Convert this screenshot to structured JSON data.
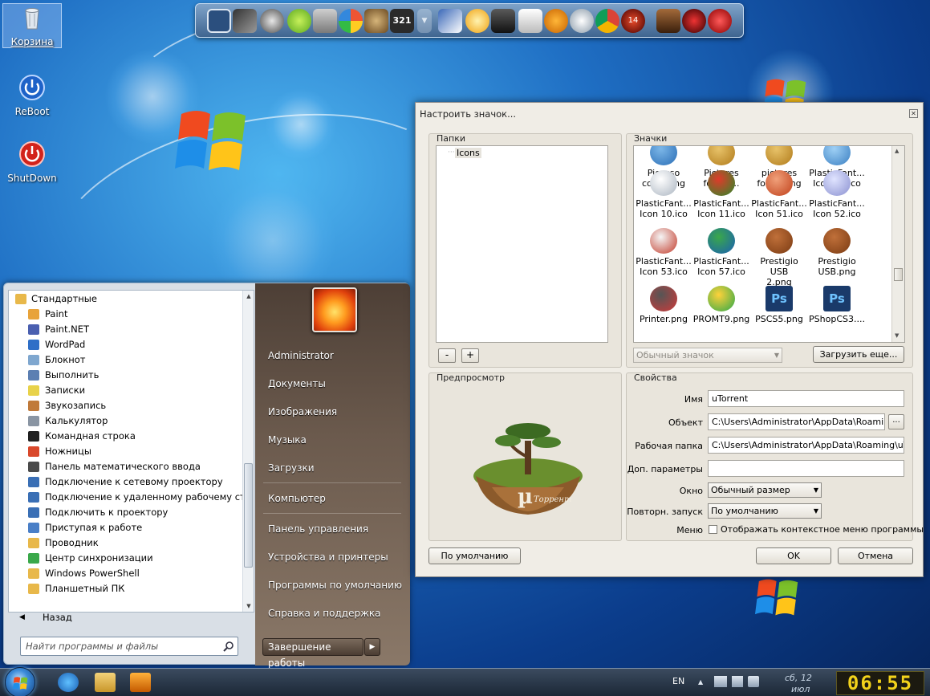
{
  "desktop": {
    "icons": [
      {
        "label": "Корзина",
        "icon": "recycle-bin-icon"
      },
      {
        "label": "ReBoot",
        "icon": "power-icon"
      },
      {
        "label": "ShutDown",
        "icon": "power-red-icon"
      }
    ]
  },
  "dock": {
    "items": [
      "tablet-icon",
      "phone-icon",
      "tools-icon",
      "skype-icon",
      "speaker-icon",
      "picasa-icon",
      "utorrent-icon",
      "media-player-321-icon",
      "dropdown-icon",
      "photo-icon",
      "alarm-clock-icon",
      "video-icon",
      "firefox-fox-icon",
      "aimp-icon",
      "fan-icon",
      "chrome-icon",
      "ccleaner-14-icon",
      "doll-icon",
      "hat-icon",
      "opera-icon"
    ]
  },
  "start_menu": {
    "folder": "Стандартные",
    "items": [
      {
        "label": "Paint",
        "color": "#e8a33a"
      },
      {
        "label": "Paint.NET",
        "color": "#4a5fb0"
      },
      {
        "label": "WordPad",
        "color": "#2f6fc7"
      },
      {
        "label": "Блокнот",
        "color": "#7fa7cf"
      },
      {
        "label": "Выполнить",
        "color": "#5c7fb2"
      },
      {
        "label": "Записки",
        "color": "#e8d24a"
      },
      {
        "label": "Звукозапись",
        "color": "#c07a3a"
      },
      {
        "label": "Калькулятор",
        "color": "#8a95a3"
      },
      {
        "label": "Командная строка",
        "color": "#202020"
      },
      {
        "label": "Ножницы",
        "color": "#d9482b"
      },
      {
        "label": "Панель математического ввода",
        "color": "#4a4a4a"
      },
      {
        "label": "Подключение к сетевому проектору",
        "color": "#3a6fb5"
      },
      {
        "label": "Подключение к удаленному рабочему стол",
        "color": "#3a6fb5"
      },
      {
        "label": "Подключить к проектору",
        "color": "#3a6fb5"
      },
      {
        "label": "Приступая к работе",
        "color": "#4a7fc7"
      },
      {
        "label": "Проводник",
        "color": "#e8b84a"
      },
      {
        "label": "Центр синхронизации",
        "color": "#3aa84a"
      },
      {
        "label": "Windows PowerShell",
        "color": "#e8b84a"
      },
      {
        "label": "Планшетный ПК",
        "color": "#e8b84a"
      }
    ],
    "back": "Назад",
    "search_placeholder": "Найти программы и файлы",
    "right_links": [
      "Administrator",
      "Документы",
      "Изображения",
      "Музыка",
      "Загрузки",
      "Компьютер",
      "Панель управления",
      "Устройства и принтеры",
      "Программы по умолчанию",
      "Справка и поддержка"
    ],
    "shutdown": "Завершение работы"
  },
  "dialog": {
    "title": "Настроить значок...",
    "folders_title": "Папки",
    "folder_item": "Icons",
    "icons_title": "Значки",
    "icons": [
      {
        "label": "Picasso copia.png",
        "line1": "Picasso",
        "line2": "copia.png"
      },
      {
        "label": "Pictures folder....",
        "line1": "Pictures",
        "line2": "folder...."
      },
      {
        "label": "pictures folder.png",
        "line1": "pictures",
        "line2": "folder.png"
      },
      {
        "label": "PlasticFant... Icon 09.ico",
        "line1": "PlasticFant...",
        "line2": "Icon 09.ico"
      },
      {
        "label": "PlasticFant... Icon 10.ico",
        "line1": "PlasticFant...",
        "line2": "Icon 10.ico"
      },
      {
        "label": "PlasticFant... Icon 11.ico",
        "line1": "PlasticFant...",
        "line2": "Icon 11.ico"
      },
      {
        "label": "PlasticFant... Icon 51.ico",
        "line1": "PlasticFant...",
        "line2": "Icon 51.ico"
      },
      {
        "label": "PlasticFant... Icon 52.ico",
        "line1": "PlasticFant...",
        "line2": "Icon 52.ico"
      },
      {
        "label": "PlasticFant... Icon 53.ico",
        "line1": "PlasticFant...",
        "line2": "Icon 53.ico"
      },
      {
        "label": "PlasticFant... Icon 57.ico",
        "line1": "PlasticFant...",
        "line2": "Icon 57.ico"
      },
      {
        "label": "Prestigio USB 2.png",
        "line1": "Prestigio USB",
        "line2": "2.png"
      },
      {
        "label": "Prestigio USB.png",
        "line1": "Prestigio",
        "line2": "USB.png"
      },
      {
        "label": "Printer.png",
        "line1": "Printer.png",
        "line2": ""
      },
      {
        "label": "PROMT9.png",
        "line1": "PROMT9.png",
        "line2": ""
      },
      {
        "label": "PSCS5.png",
        "line1": "PSCS5.png",
        "line2": ""
      },
      {
        "label": "PShopCS3....",
        "line1": "PShopCS3....",
        "line2": ""
      }
    ],
    "minus": "-",
    "plus": "+",
    "icon_type": "Обычный значок",
    "load_more": "Загрузить еще...",
    "preview_title": "Предпросмотр",
    "preview_caption": "Торрент",
    "props_title": "Свойства",
    "props": {
      "name_label": "Имя",
      "name_value": "uTorrent",
      "object_label": "Объект",
      "object_value": "C:\\Users\\Administrator\\AppData\\Roaming\\uTorrent\\uTorrent.exe",
      "browse": "...",
      "workdir_label": "Рабочая папка",
      "workdir_value": "C:\\Users\\Administrator\\AppData\\Roaming\\uTorrent",
      "params_label": "Доп. параметры",
      "params_value": "",
      "window_label": "Окно",
      "window_value": "Обычный размер",
      "relaunch_label": "Повторн. запуск",
      "relaunch_value": "По умолчанию",
      "menu_label": "Меню",
      "menu_checkbox": "Отображать контекстное меню программы"
    },
    "default_btn": "По умолчанию",
    "ok": "OK",
    "cancel": "Отмена"
  },
  "taskbar": {
    "lang": "EN",
    "date_line1": "сб, 12",
    "date_line2": "июл",
    "time": "06:55"
  }
}
